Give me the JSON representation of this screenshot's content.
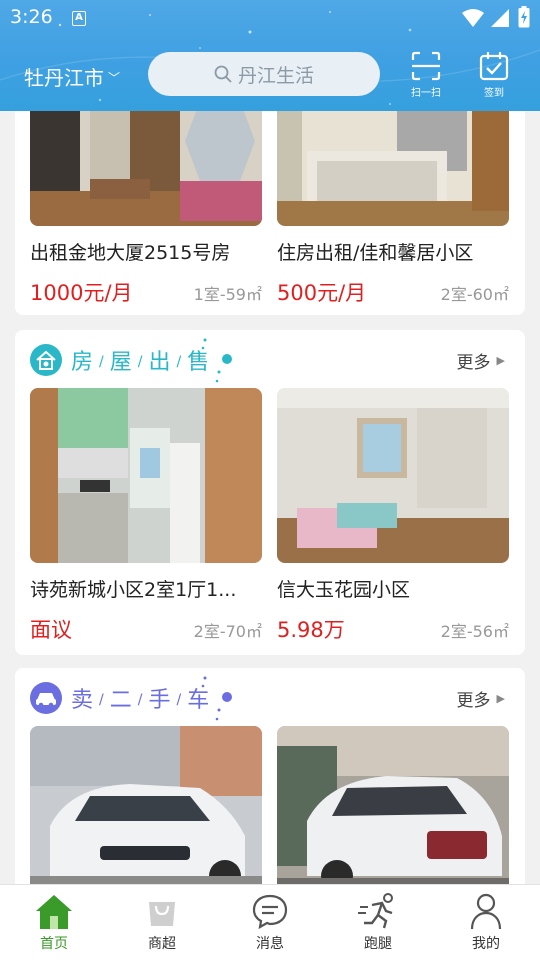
{
  "status_bar": {
    "time": "3:26",
    "notification_letter": "A"
  },
  "header": {
    "city": "牡丹江市",
    "search_placeholder": "丹江生活",
    "scan_label": "扫一扫",
    "checkin_label": "签到"
  },
  "top_listings": [
    {
      "name": "出租金地大厦2515号房",
      "price": "1000元/月",
      "spec": "1室-59㎡"
    },
    {
      "name": "住房出租/佳和馨居小区",
      "price": "500元/月",
      "spec": "2室-60㎡"
    }
  ],
  "house_sale": {
    "title_chars": [
      "房",
      "屋",
      "出",
      "售"
    ],
    "more": "更多",
    "accent": "#2ab8c8",
    "items": [
      {
        "name": "诗苑新城小区2室1厅1...",
        "price": "面议",
        "spec": "2室-70㎡"
      },
      {
        "name": "信大玉花园小区",
        "price": "5.98万",
        "spec": "2室-56㎡"
      }
    ]
  },
  "used_car": {
    "title_chars": [
      "卖",
      "二",
      "手",
      "车"
    ],
    "more": "更多",
    "accent": "#6a6ee0"
  },
  "tabs": [
    {
      "label": "首页",
      "icon": "home-icon"
    },
    {
      "label": "商超",
      "icon": "shopping-bag-icon"
    },
    {
      "label": "消息",
      "icon": "message-icon"
    },
    {
      "label": "跑腿",
      "icon": "runner-icon"
    },
    {
      "label": "我的",
      "icon": "user-icon"
    }
  ],
  "colors": {
    "header_blue": "#3fa0e2",
    "price_red": "#e02020",
    "active_green": "#3a9a2a"
  }
}
